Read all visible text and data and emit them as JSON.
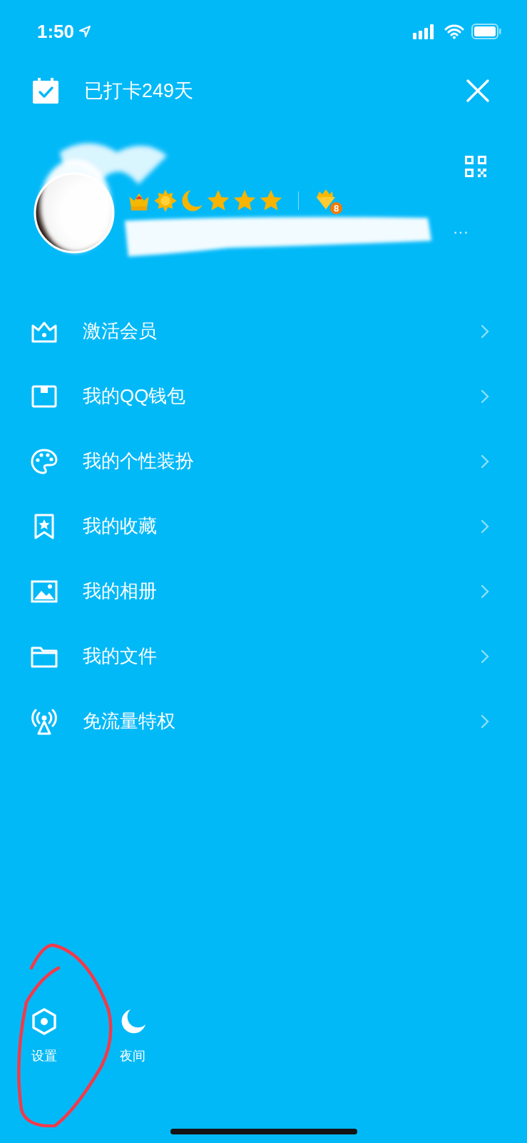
{
  "status_bar": {
    "time": "1:50"
  },
  "header": {
    "checkin_text": "已打卡249天"
  },
  "profile": {
    "badges": [
      {
        "kind": "crown"
      },
      {
        "kind": "sun"
      },
      {
        "kind": "moon"
      },
      {
        "kind": "star"
      },
      {
        "kind": "star"
      },
      {
        "kind": "star"
      }
    ],
    "vip_level": "8",
    "more": "···"
  },
  "menu": [
    {
      "kind": "crown",
      "label": "激活会员"
    },
    {
      "kind": "wallet",
      "label": "我的QQ钱包"
    },
    {
      "kind": "palette",
      "label": "我的个性装扮"
    },
    {
      "kind": "bookmark",
      "label": "我的收藏"
    },
    {
      "kind": "image",
      "label": "我的相册"
    },
    {
      "kind": "folder",
      "label": "我的文件"
    },
    {
      "kind": "antenna",
      "label": "免流量特权"
    }
  ],
  "bottom": [
    {
      "kind": "settings",
      "label": "设置"
    },
    {
      "kind": "moon",
      "label": "夜间"
    }
  ]
}
